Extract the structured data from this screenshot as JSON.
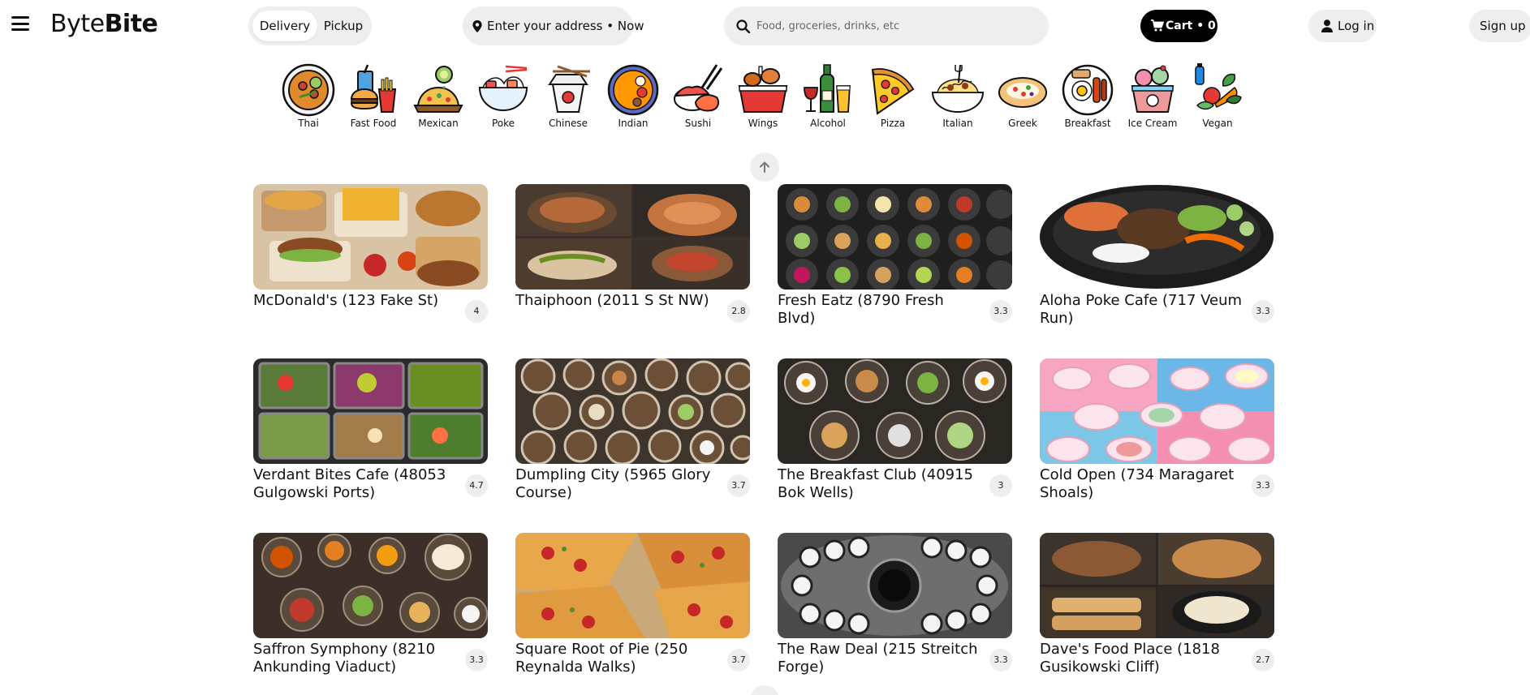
{
  "header": {
    "logo_light": "Byte",
    "logo_bold": "Bite",
    "mode": {
      "delivery_label": "Delivery",
      "pickup_label": "Pickup",
      "selected": "Delivery"
    },
    "address": {
      "label": "Enter your address",
      "time": "Now"
    },
    "search": {
      "placeholder": "Food, groceries, drinks, etc"
    },
    "cart": {
      "label": "Cart • 0"
    },
    "login_label": "Log in",
    "signup_label": "Sign up"
  },
  "categories": [
    {
      "label": "Thai",
      "icon": "thai-food-icon"
    },
    {
      "label": "Fast Food",
      "icon": "fast-food-icon"
    },
    {
      "label": "Mexican",
      "icon": "mexican-food-icon"
    },
    {
      "label": "Poke",
      "icon": "poke-bowl-icon"
    },
    {
      "label": "Chinese",
      "icon": "chinese-takeout-icon"
    },
    {
      "label": "Indian",
      "icon": "indian-food-icon"
    },
    {
      "label": "Sushi",
      "icon": "sushi-icon"
    },
    {
      "label": "Wings",
      "icon": "wings-icon"
    },
    {
      "label": "Alcohol",
      "icon": "alcohol-icon"
    },
    {
      "label": "Pizza",
      "icon": "pizza-icon"
    },
    {
      "label": "Italian",
      "icon": "italian-pasta-icon"
    },
    {
      "label": "Greek",
      "icon": "greek-food-icon"
    },
    {
      "label": "Breakfast",
      "icon": "breakfast-icon"
    },
    {
      "label": "Ice Cream",
      "icon": "ice-cream-icon"
    },
    {
      "label": "Vegan",
      "icon": "vegan-icon"
    }
  ],
  "restaurants": [
    {
      "name": "McDonald's (123 Fake St)",
      "rating": "4"
    },
    {
      "name": "Thaiphoon (2011 S St NW)",
      "rating": "2.8"
    },
    {
      "name": "Fresh Eatz (8790 Fresh Blvd)",
      "rating": "3.3"
    },
    {
      "name": "Aloha Poke Cafe (717 Veum Run)",
      "rating": "3.3"
    },
    {
      "name": "Verdant Bites Cafe (48053 Gulgowski Ports)",
      "rating": "4.7"
    },
    {
      "name": "Dumpling City (5965 Glory Course)",
      "rating": "3.7"
    },
    {
      "name": "The Breakfast Club (40915 Bok Wells)",
      "rating": "3"
    },
    {
      "name": "Cold Open (734 Maragaret Shoals)",
      "rating": "3.3"
    },
    {
      "name": "Saffron Symphony (8210 Ankunding Viaduct)",
      "rating": "3.3"
    },
    {
      "name": "Square Root of Pie (250 Reynalda Walks)",
      "rating": "3.7"
    },
    {
      "name": "The Raw Deal (215 Streitch Forge)",
      "rating": "3.3"
    },
    {
      "name": "Dave's Food Place (1818 Gusikowski Cliff)",
      "rating": "2.7"
    }
  ],
  "colors": {
    "accent": "#000000",
    "pill_background": "#eeeeee",
    "page_background": "#ffffff"
  }
}
